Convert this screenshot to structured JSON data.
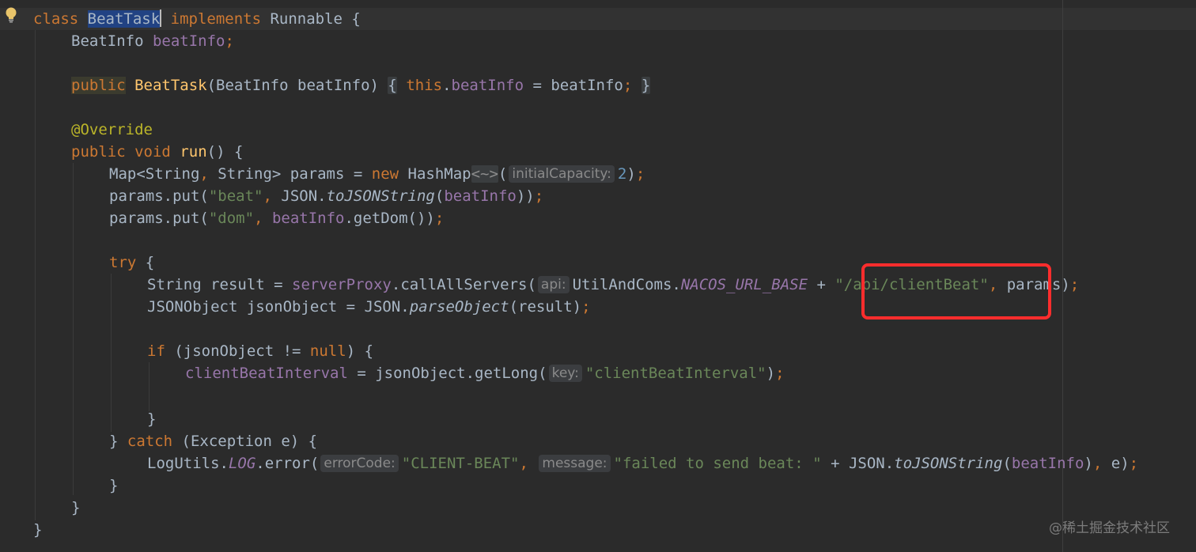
{
  "hints": {
    "initial_capacity": "initialCapacity:",
    "api": "api:",
    "key": "key:",
    "error_code": "errorCode:",
    "message": "message:"
  },
  "code": {
    "l1": {
      "kw": "class",
      "name": "BeatTask",
      "impl": "implements",
      "iface": "Runnable {"
    },
    "l2": {
      "type": "BeatInfo ",
      "field": "beatInfo",
      "semi": ";"
    },
    "l3": {
      "kw": "public",
      "name": "BeatTask",
      "params": "(BeatInfo beatInfo)",
      "open": "{",
      "this": "this",
      "dot": ".",
      "field": "beatInfo",
      "assign": " = beatInfo",
      "semi": ";",
      "close": "}"
    },
    "l4": {
      "ann": "@Override"
    },
    "l5": {
      "kw1": "public",
      "kw2": "void",
      "name": "run",
      "rest": "() {"
    },
    "l6": {
      "pre": "Map<String",
      "comma": ",",
      "mid": " String> params = ",
      "new": "new",
      "cls": " HashMap",
      "diamond": "<~>",
      "open": "(",
      "num": "2",
      "close": ")",
      "semi": ";"
    },
    "l7": {
      "pre": "params.put(",
      "str": "\"beat\"",
      "comma": ",",
      "json": " JSON.",
      "method": "toJSONString",
      "open": "(",
      "field": "beatInfo",
      "close": "))",
      "semi": ";"
    },
    "l8": {
      "pre": "params.put(",
      "str": "\"dom\"",
      "comma": ",",
      "field": "beatInfo",
      "rest": ".getDom())",
      "semi": ";"
    },
    "l9": {
      "kw": "try",
      "rest": " {"
    },
    "l10": {
      "pre": "String result = ",
      "field": "serverProxy",
      "call": ".callAllServers(",
      "cls": "UtilAndComs.",
      "const": "NACOS_URL_BASE",
      "plus": " + ",
      "str": "\"/api/clientBeat\"",
      "comma": ",",
      "rest": " params)",
      "semi": ";"
    },
    "l11": {
      "pre": "JSONObject jsonObject = JSON.",
      "method": "parseObject",
      "rest": "(result)",
      "semi": ";"
    },
    "l12": {
      "kw": "if",
      "mid": " (jsonObject != ",
      "null": "null",
      "rest": ") {"
    },
    "l13": {
      "field": "clientBeatInterval",
      "mid": " = jsonObject.getLong(",
      "str": "\"clientBeatInterval\"",
      "rest": ")",
      "semi": ";"
    },
    "l14": {
      "text": "}"
    },
    "l15": {
      "pre": "} ",
      "kw": "catch",
      "rest": " (Exception e) {"
    },
    "l16": {
      "pre": "LogUtils.",
      "const": "LOG",
      "call": ".error(",
      "str1": "\"CLIENT-BEAT\"",
      "comma": ",",
      "str2": "\"failed to send beat: \"",
      "plus": " + JSON.",
      "method": "toJSONString",
      "open": "(",
      "field": "beatInfo",
      "close": ")",
      "comma2": ",",
      "rest": " e)",
      "semi": ";"
    },
    "l17": {
      "text": "}"
    },
    "l18": {
      "text": "}"
    },
    "l19": {
      "text": "}"
    }
  },
  "watermark": "@稀土掘金技术社区",
  "colors": {
    "background": "#2b2b2b",
    "keyword": "#cc7832",
    "string": "#6a8759",
    "field": "#9876aa",
    "method_decl": "#ffc66d",
    "number": "#6897bb",
    "annotation": "#bbb529",
    "highlight_box": "#ff2d2d"
  },
  "icons": {
    "intention": "lightbulb-icon"
  }
}
